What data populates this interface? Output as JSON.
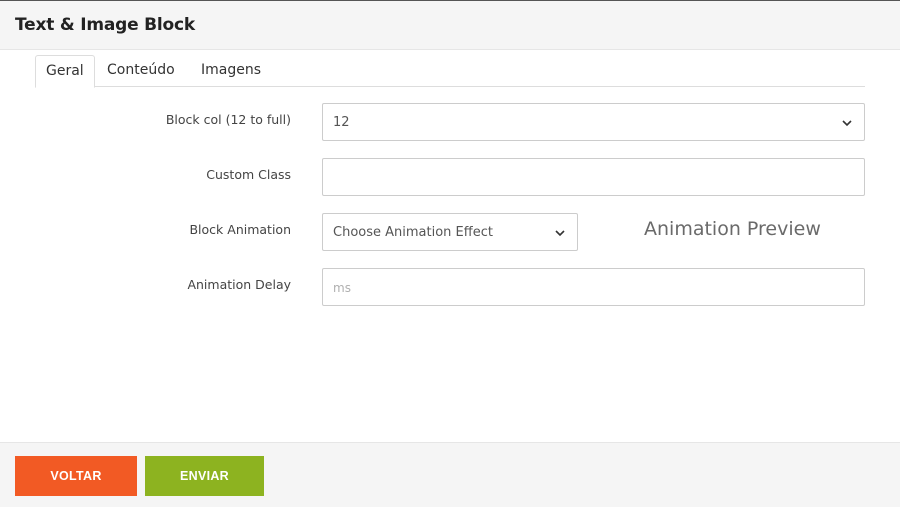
{
  "modal": {
    "title": "Text & Image Block"
  },
  "tabs": [
    {
      "label": "Geral",
      "active": true
    },
    {
      "label": "Conteúdo",
      "active": false
    },
    {
      "label": "Imagens",
      "active": false
    }
  ],
  "form": {
    "block_col": {
      "label": "Block col (12 to full)",
      "value": "12"
    },
    "custom_class": {
      "label": "Custom Class",
      "value": ""
    },
    "block_animation": {
      "label": "Block Animation",
      "value": "Choose Animation Effect"
    },
    "animation_preview": "Animation Preview",
    "animation_delay": {
      "label": "Animation Delay",
      "placeholder": "ms"
    }
  },
  "footer": {
    "back_label": "VOLTAR",
    "submit_label": "ENVIAR"
  },
  "colors": {
    "back_button": "#f25a24",
    "submit_button": "#8db320"
  },
  "icons": {
    "select_arrow": "chevron-down-icon"
  }
}
